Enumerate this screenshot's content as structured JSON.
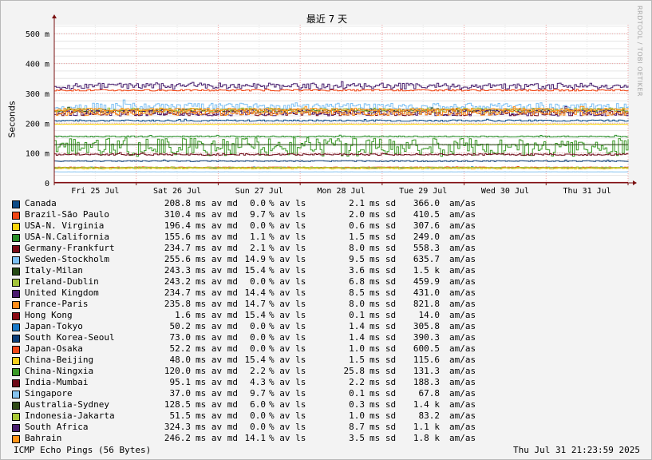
{
  "chart_data": {
    "type": "line",
    "title": "最近 7 天",
    "ylabel": "Seconds",
    "xlabel": "",
    "watermark": "RRDTOOL / TOBI OETIKER",
    "ylim": [
      0,
      0.53
    ],
    "y_ticks": [
      {
        "value": 0,
        "label": "0"
      },
      {
        "value": 0.1,
        "label": "100 m"
      },
      {
        "value": 0.2,
        "label": "200 m"
      },
      {
        "value": 0.3,
        "label": "300 m"
      },
      {
        "value": 0.4,
        "label": "400 m"
      },
      {
        "value": 0.5,
        "label": "500 m"
      }
    ],
    "x_ticks": [
      "Fri 25 Jul",
      "Sat 26 Jul",
      "Sun 27 Jul",
      "Mon 28 Jul",
      "Tue 29 Jul",
      "Wed 30 Jul",
      "Thu 31 Jul"
    ],
    "grid": true,
    "legend_position": "bottom",
    "series": [
      {
        "name": "Canada",
        "color": "#0b4a86",
        "avg": "208.8",
        "avg_unit": "ms av md",
        "loss": "0.0",
        "loss_unit": "% av ls",
        "sd": "2.1",
        "sd_unit": "ms sd",
        "am": "366.0",
        "am_unit": "am/as"
      },
      {
        "name": "Brazil-São Paulo",
        "color": "#f04515",
        "avg": "310.4",
        "avg_unit": "ms av md",
        "loss": "9.7",
        "loss_unit": "% av ls",
        "sd": "2.0",
        "sd_unit": "ms sd",
        "am": "410.5",
        "am_unit": "am/as"
      },
      {
        "name": "USA-N. Virginia",
        "color": "#f8d40a",
        "avg": "196.4",
        "avg_unit": "ms av md",
        "loss": "0.0",
        "loss_unit": "% av ls",
        "sd": "0.6",
        "sd_unit": "ms sd",
        "am": "307.6",
        "am_unit": "am/as"
      },
      {
        "name": "USA-N.California",
        "color": "#2a8f2a",
        "avg": "155.6",
        "avg_unit": "ms av md",
        "loss": "1.1",
        "loss_unit": "% av ls",
        "sd": "1.5",
        "sd_unit": "ms sd",
        "am": "249.0",
        "am_unit": "am/as"
      },
      {
        "name": "Germany-Frankfurt",
        "color": "#7a0a16",
        "avg": "234.7",
        "avg_unit": "ms av md",
        "loss": "2.1",
        "loss_unit": "% av ls",
        "sd": "8.0",
        "sd_unit": "ms sd",
        "am": "558.3",
        "am_unit": "am/as"
      },
      {
        "name": "Sweden-Stockholm",
        "color": "#7cc0f4",
        "avg": "255.6",
        "avg_unit": "ms av md",
        "loss": "14.9",
        "loss_unit": "% av ls",
        "sd": "9.5",
        "sd_unit": "ms sd",
        "am": "635.7",
        "am_unit": "am/as"
      },
      {
        "name": "Italy-Milan",
        "color": "#254a14",
        "avg": "243.3",
        "avg_unit": "ms av md",
        "loss": "15.4",
        "loss_unit": "% av ls",
        "sd": "3.6",
        "sd_unit": "ms sd",
        "am": "1.5 k",
        "am_unit": "am/as"
      },
      {
        "name": "Ireland-Dublin",
        "color": "#a3c43a",
        "avg": "243.2",
        "avg_unit": "ms av md",
        "loss": "0.0",
        "loss_unit": "% av ls",
        "sd": "6.8",
        "sd_unit": "ms sd",
        "am": "459.9",
        "am_unit": "am/as"
      },
      {
        "name": "United Kingdom",
        "color": "#4a1a6e",
        "avg": "234.7",
        "avg_unit": "ms av md",
        "loss": "14.4",
        "loss_unit": "% av ls",
        "sd": "8.5",
        "sd_unit": "ms sd",
        "am": "431.0",
        "am_unit": "am/as"
      },
      {
        "name": "France-Paris",
        "color": "#ff8c1a",
        "avg": "235.8",
        "avg_unit": "ms av md",
        "loss": "14.7",
        "loss_unit": "% av ls",
        "sd": "8.0",
        "sd_unit": "ms sd",
        "am": "821.8",
        "am_unit": "am/as"
      },
      {
        "name": "Hong Kong",
        "color": "#8a0a14",
        "avg": "1.6",
        "avg_unit": "ms av md",
        "loss": "15.4",
        "loss_unit": "% av ls",
        "sd": "0.1",
        "sd_unit": "ms sd",
        "am": "14.0",
        "am_unit": "am/as"
      },
      {
        "name": "Japan-Tokyo",
        "color": "#1a7ac8",
        "avg": "50.2",
        "avg_unit": "ms av md",
        "loss": "0.0",
        "loss_unit": "% av ls",
        "sd": "1.4",
        "sd_unit": "ms sd",
        "am": "305.8",
        "am_unit": "am/as"
      },
      {
        "name": "South Korea-Seoul",
        "color": "#0d3f7a",
        "avg": "73.0",
        "avg_unit": "ms av md",
        "loss": "0.0",
        "loss_unit": "% av ls",
        "sd": "1.4",
        "sd_unit": "ms sd",
        "am": "390.3",
        "am_unit": "am/as"
      },
      {
        "name": "Japan-Osaka",
        "color": "#f0481a",
        "avg": "52.2",
        "avg_unit": "ms av md",
        "loss": "0.0",
        "loss_unit": "% av ls",
        "sd": "1.0",
        "sd_unit": "ms sd",
        "am": "600.5",
        "am_unit": "am/as"
      },
      {
        "name": "China-Beijing",
        "color": "#f8d020",
        "avg": "48.0",
        "avg_unit": "ms av md",
        "loss": "15.4",
        "loss_unit": "% av ls",
        "sd": "1.5",
        "sd_unit": "ms sd",
        "am": "115.6",
        "am_unit": "am/as"
      },
      {
        "name": "China-Ningxia",
        "color": "#3a9a26",
        "avg": "120.0",
        "avg_unit": "ms av md",
        "loss": "2.2",
        "loss_unit": "% av ls",
        "sd": "25.8",
        "sd_unit": "ms sd",
        "am": "131.3",
        "am_unit": "am/as"
      },
      {
        "name": "India-Mumbai",
        "color": "#6e0a18",
        "avg": "95.1",
        "avg_unit": "ms av md",
        "loss": "4.3",
        "loss_unit": "% av ls",
        "sd": "2.2",
        "sd_unit": "ms sd",
        "am": "188.3",
        "am_unit": "am/as"
      },
      {
        "name": "Singapore",
        "color": "#86c4f0",
        "avg": "37.0",
        "avg_unit": "ms av md",
        "loss": "9.7",
        "loss_unit": "% av ls",
        "sd": "0.1",
        "sd_unit": "ms sd",
        "am": "67.8",
        "am_unit": "am/as"
      },
      {
        "name": "Australia-Sydney",
        "color": "#2f4a16",
        "avg": "128.5",
        "avg_unit": "ms av md",
        "loss": "6.0",
        "loss_unit": "% av ls",
        "sd": "0.3",
        "sd_unit": "ms sd",
        "am": "1.4 k",
        "am_unit": "am/as"
      },
      {
        "name": "Indonesia-Jakarta",
        "color": "#a8c834",
        "avg": "51.5",
        "avg_unit": "ms av md",
        "loss": "0.0",
        "loss_unit": "% av ls",
        "sd": "1.0",
        "sd_unit": "ms sd",
        "am": "83.2",
        "am_unit": "am/as"
      },
      {
        "name": "South Africa",
        "color": "#4a2070",
        "avg": "324.3",
        "avg_unit": "ms av md",
        "loss": "0.0",
        "loss_unit": "% av ls",
        "sd": "8.7",
        "sd_unit": "ms sd",
        "am": "1.1 k",
        "am_unit": "am/as"
      },
      {
        "name": "Bahrain",
        "color": "#ff9418",
        "avg": "246.2",
        "avg_unit": "ms av md",
        "loss": "14.1",
        "loss_unit": "% av ls",
        "sd": "3.5",
        "sd_unit": "ms sd",
        "am": "1.8 k",
        "am_unit": "am/as"
      }
    ]
  },
  "footer": {
    "left": "ICMP Echo Pings (56 Bytes)",
    "right": "Thu Jul 31 21:23:59 2025"
  }
}
